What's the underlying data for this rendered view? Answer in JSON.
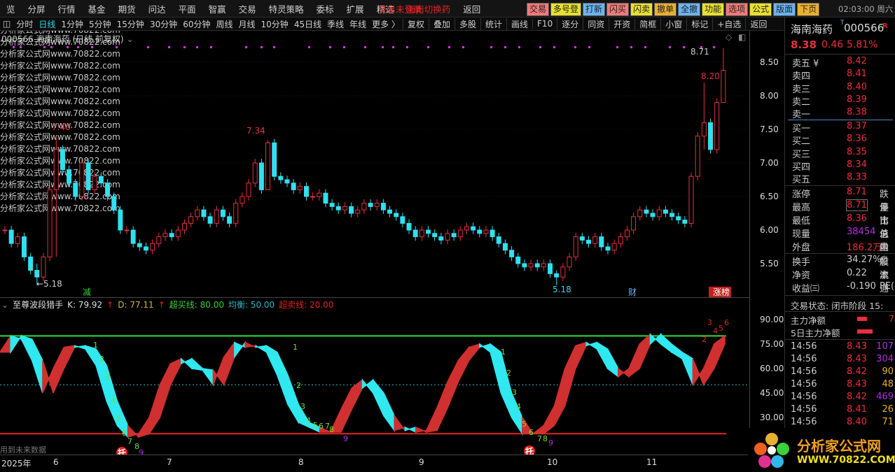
{
  "menu": [
    "览",
    "分屏",
    "行情",
    "基金",
    "期货",
    "问达",
    "平面",
    "智赢",
    "交易",
    "特灵策略",
    "委标",
    "扩展",
    "精选",
    "海南切换药",
    "返回"
  ],
  "menu_overlay": "交易未登录",
  "top_buttons": [
    {
      "label": "交易",
      "color": "#f07a7a"
    },
    {
      "label": "多号登",
      "color": "#e8e030"
    },
    {
      "label": "打新",
      "color": "#6cb4f0"
    },
    {
      "label": "闪买",
      "color": "#f07a7a"
    },
    {
      "label": "闪卖",
      "color": "#e8e030"
    },
    {
      "label": "撤单",
      "color": "#e8b030"
    },
    {
      "label": "全撤",
      "color": "#6cb4f0"
    },
    {
      "label": "功能",
      "color": "#e8e030"
    },
    {
      "label": "选项",
      "color": "#f07a7a"
    },
    {
      "label": "公式",
      "color": "#e8e030"
    },
    {
      "label": "版面",
      "color": "#6cb4f0"
    },
    {
      "label": "下页",
      "color": "#e8b030"
    }
  ],
  "clock": "02:03:00 周六",
  "periods": [
    "分时",
    "日线",
    "1分钟",
    "5分钟",
    "15分钟",
    "30分钟",
    "60分钟",
    "周线",
    "月线",
    "10分钟",
    "45日线",
    "季线",
    "年线",
    "更多 〉"
  ],
  "active_period": "日线",
  "tools": [
    "复权",
    "叠加",
    "多股",
    "统计",
    "画线",
    "F10",
    "逐分",
    "同资",
    "开资",
    "简框",
    "小窗",
    "标记",
    "+自选",
    "返回"
  ],
  "chart_title": "000566 海南海药 (日线,前复权)",
  "watermark": "分析家公式网www.70822.com",
  "price_axis": [
    "8.50",
    "8.00",
    "7.50",
    "7.00",
    "6.50",
    "6.00",
    "5.50"
  ],
  "ind_axis": [
    "90.00",
    "75.00",
    "60.00",
    "45.00",
    "30.00"
  ],
  "chart_data": [
    {
      "type": "candlestick",
      "title": "000566 海南海药 (日线,前复权)",
      "ylim": [
        5.0,
        8.9
      ],
      "closes": [
        6.0,
        5.8,
        5.9,
        5.6,
        5.4,
        5.3,
        5.6,
        6.6,
        7.2,
        6.9,
        6.7,
        6.5,
        7.0,
        6.6,
        6.8,
        6.7,
        6.5,
        6.3,
        6.0,
        6.0,
        5.8,
        5.75,
        5.7,
        5.8,
        5.9,
        5.95,
        5.9,
        6.0,
        6.1,
        6.2,
        6.3,
        6.2,
        6.1,
        6.3,
        6.2,
        6.1,
        6.4,
        6.5,
        6.7,
        7.0,
        6.6,
        7.3,
        6.8,
        6.75,
        6.7,
        6.6,
        6.65,
        6.5,
        6.5,
        6.55,
        6.4,
        6.35,
        6.3,
        6.35,
        6.25,
        6.3,
        6.4,
        6.35,
        6.4,
        6.3,
        6.25,
        6.2,
        6.1,
        6.0,
        5.9,
        6.0,
        5.95,
        5.9,
        5.85,
        5.95,
        5.9,
        6.0,
        6.05,
        6.0,
        5.95,
        6.0,
        5.9,
        5.8,
        5.7,
        5.6,
        5.5,
        5.45,
        5.5,
        5.45,
        5.5,
        5.35,
        5.3,
        5.45,
        5.6,
        5.9,
        5.85,
        5.8,
        5.9,
        5.75,
        5.7,
        5.8,
        5.9,
        6.0,
        6.2,
        6.3,
        6.25,
        6.2,
        6.3,
        6.25,
        6.2,
        6.15,
        6.1,
        6.8,
        7.4,
        7.6,
        7.2,
        7.9,
        8.38
      ],
      "extremes": {
        "8": [
          7.4,
          5.6
        ],
        "5": [
          5.5,
          5.18
        ],
        "41": [
          7.34,
          6.8
        ],
        "86": [
          5.4,
          5.18
        ],
        "109": [
          8.2,
          7.2
        ],
        "112": [
          8.71,
          8.38
        ]
      },
      "labels": [
        {
          "text": "7.40",
          "color": "#e8303e"
        },
        {
          "text": "←5.18",
          "color": "#ccc"
        },
        {
          "text": "7.34",
          "color": "#e8303e"
        },
        {
          "text": "5.18",
          "color": "#2fd6e6"
        },
        {
          "text": "8.20",
          "color": "#e8303e"
        },
        {
          "text": "8.71",
          "color": "#ccc"
        }
      ],
      "events": [
        {
          "text": "减",
          "color": "#3ad13a"
        },
        {
          "text": "财",
          "color": "#6cb4f0"
        },
        {
          "text": "涨榜",
          "color": "#fff"
        }
      ]
    },
    {
      "type": "line",
      "title": "至尊波段猎手",
      "ylim": [
        0,
        100
      ],
      "k": [
        70,
        80,
        78,
        65,
        45,
        60,
        73,
        74,
        72,
        62,
        40,
        25,
        18,
        20,
        30,
        50,
        63,
        66,
        60,
        59,
        50,
        67,
        76,
        73,
        74,
        70,
        56,
        38,
        27,
        24,
        21,
        21,
        35,
        48,
        53,
        45,
        31,
        22,
        24,
        21,
        22,
        36,
        52,
        65,
        73,
        75,
        70,
        45,
        30,
        20,
        20,
        25,
        37,
        60,
        74,
        76,
        72,
        60,
        55,
        60,
        75,
        81,
        75,
        70,
        66,
        50,
        60,
        75,
        80
      ],
      "d_lag": 1,
      "overbought": 80,
      "balance": 50,
      "oversold": 20,
      "counts": [
        "1",
        "2",
        "3",
        "4",
        "5",
        "6",
        "7",
        "8",
        "9"
      ]
    }
  ],
  "indicator": {
    "name": "至尊波段猎手",
    "k": "K: 79.92",
    "d": "D: 77.11",
    "ob": "超买线: 80.00",
    "bal": "均衡: 50.00",
    "os": "超卖线: 20.00",
    "note": "用到未来数据",
    "tuo": "托"
  },
  "dates": [
    "2025年",
    "6",
    "7",
    "8",
    "9",
    "10",
    "11"
  ],
  "quote": {
    "name": "海南海药",
    "code": "000566",
    "t": "T",
    "r": "R",
    "price": "8.38",
    "chg": "0.46",
    "pct": "5.81%",
    "asks": [
      [
        "卖五 ¥",
        "8.42"
      ],
      [
        "卖四",
        "8.41"
      ],
      [
        "卖三",
        "8.40"
      ],
      [
        "卖二",
        "8.39"
      ],
      [
        "卖一",
        "8.38"
      ]
    ],
    "bids": [
      [
        "买一",
        "8.37"
      ],
      [
        "买二",
        "8.36"
      ],
      [
        "买三",
        "8.35"
      ],
      [
        "买四",
        "8.34"
      ],
      [
        "买五",
        "8.33"
      ]
    ],
    "stats": [
      [
        "涨停",
        "8.71",
        "跌停"
      ],
      [
        "最高",
        "8.71",
        "量比"
      ],
      [
        "最低",
        "8.36",
        "市值"
      ],
      [
        "现量",
        "38454",
        "总量"
      ],
      [
        "外盘",
        "186.2万",
        "内盘"
      ]
    ],
    "stats2": [
      [
        "换手",
        "34.27%",
        "股本"
      ],
      [
        "净资",
        "0.22",
        "流通"
      ],
      [
        "收益㈢",
        "-0.190",
        "PE("
      ]
    ],
    "status": "交易状态: 闭市阶段 15:",
    "flow": [
      [
        "主力净额",
        "7"
      ],
      [
        "5日主力净额",
        ""
      ]
    ],
    "ticks": [
      [
        "14:56",
        "8.43",
        "107",
        "#b030e0"
      ],
      [
        "14:56",
        "8.43",
        "304",
        "#b030e0"
      ],
      [
        "14:56",
        "8.42",
        "90",
        "#e8b030"
      ],
      [
        "14:56",
        "8.43",
        "48",
        "#e8b030"
      ],
      [
        "14:56",
        "8.42",
        "469",
        "#b030e0"
      ],
      [
        "14:56",
        "8.41",
        "26",
        "#e8b030"
      ],
      [
        "14:56",
        "8.40",
        "71",
        "#e8b030"
      ]
    ]
  },
  "logo": {
    "cn": "分析家公式网",
    "url": "WWW.70822.COM"
  }
}
